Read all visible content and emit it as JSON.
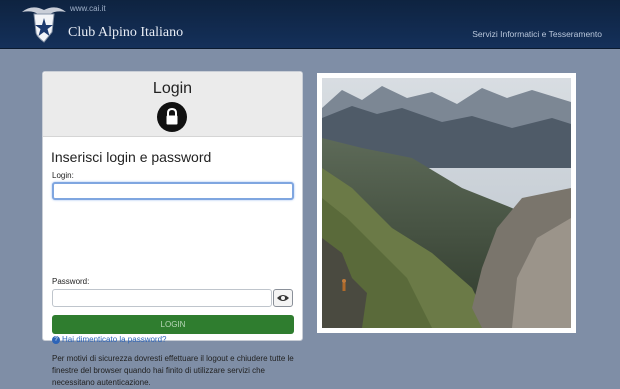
{
  "header": {
    "site_url": "www.cai.it",
    "brand": "Club Alpino Italiano",
    "service": "Servizi Informatici e Tesseramento",
    "logo_icon": "cai-eagle-star-logo"
  },
  "login_panel": {
    "title": "Login",
    "lock_icon": "lock-icon",
    "subtitle": "Inserisci login e password",
    "login_label": "Login:",
    "login_value": "",
    "password_label": "Password:",
    "password_value": "",
    "show_password_icon": "eye-icon",
    "submit_label": "LOGIN",
    "forgot_label": "Hai dimenticato la password?",
    "notice": "Per motivi di sicurezza dovresti effettuare il logout e chiudere tutte le finestre del browser quando hai finito di utilizzare servizi che necessitano autenticazione."
  },
  "photo": {
    "subject": "mountain-landscape-photo"
  },
  "colors": {
    "page_bg": "#7f8ea6",
    "header_bg": "#14305a",
    "button_green": "#2f7d2f",
    "link_blue": "#2b63b8"
  }
}
